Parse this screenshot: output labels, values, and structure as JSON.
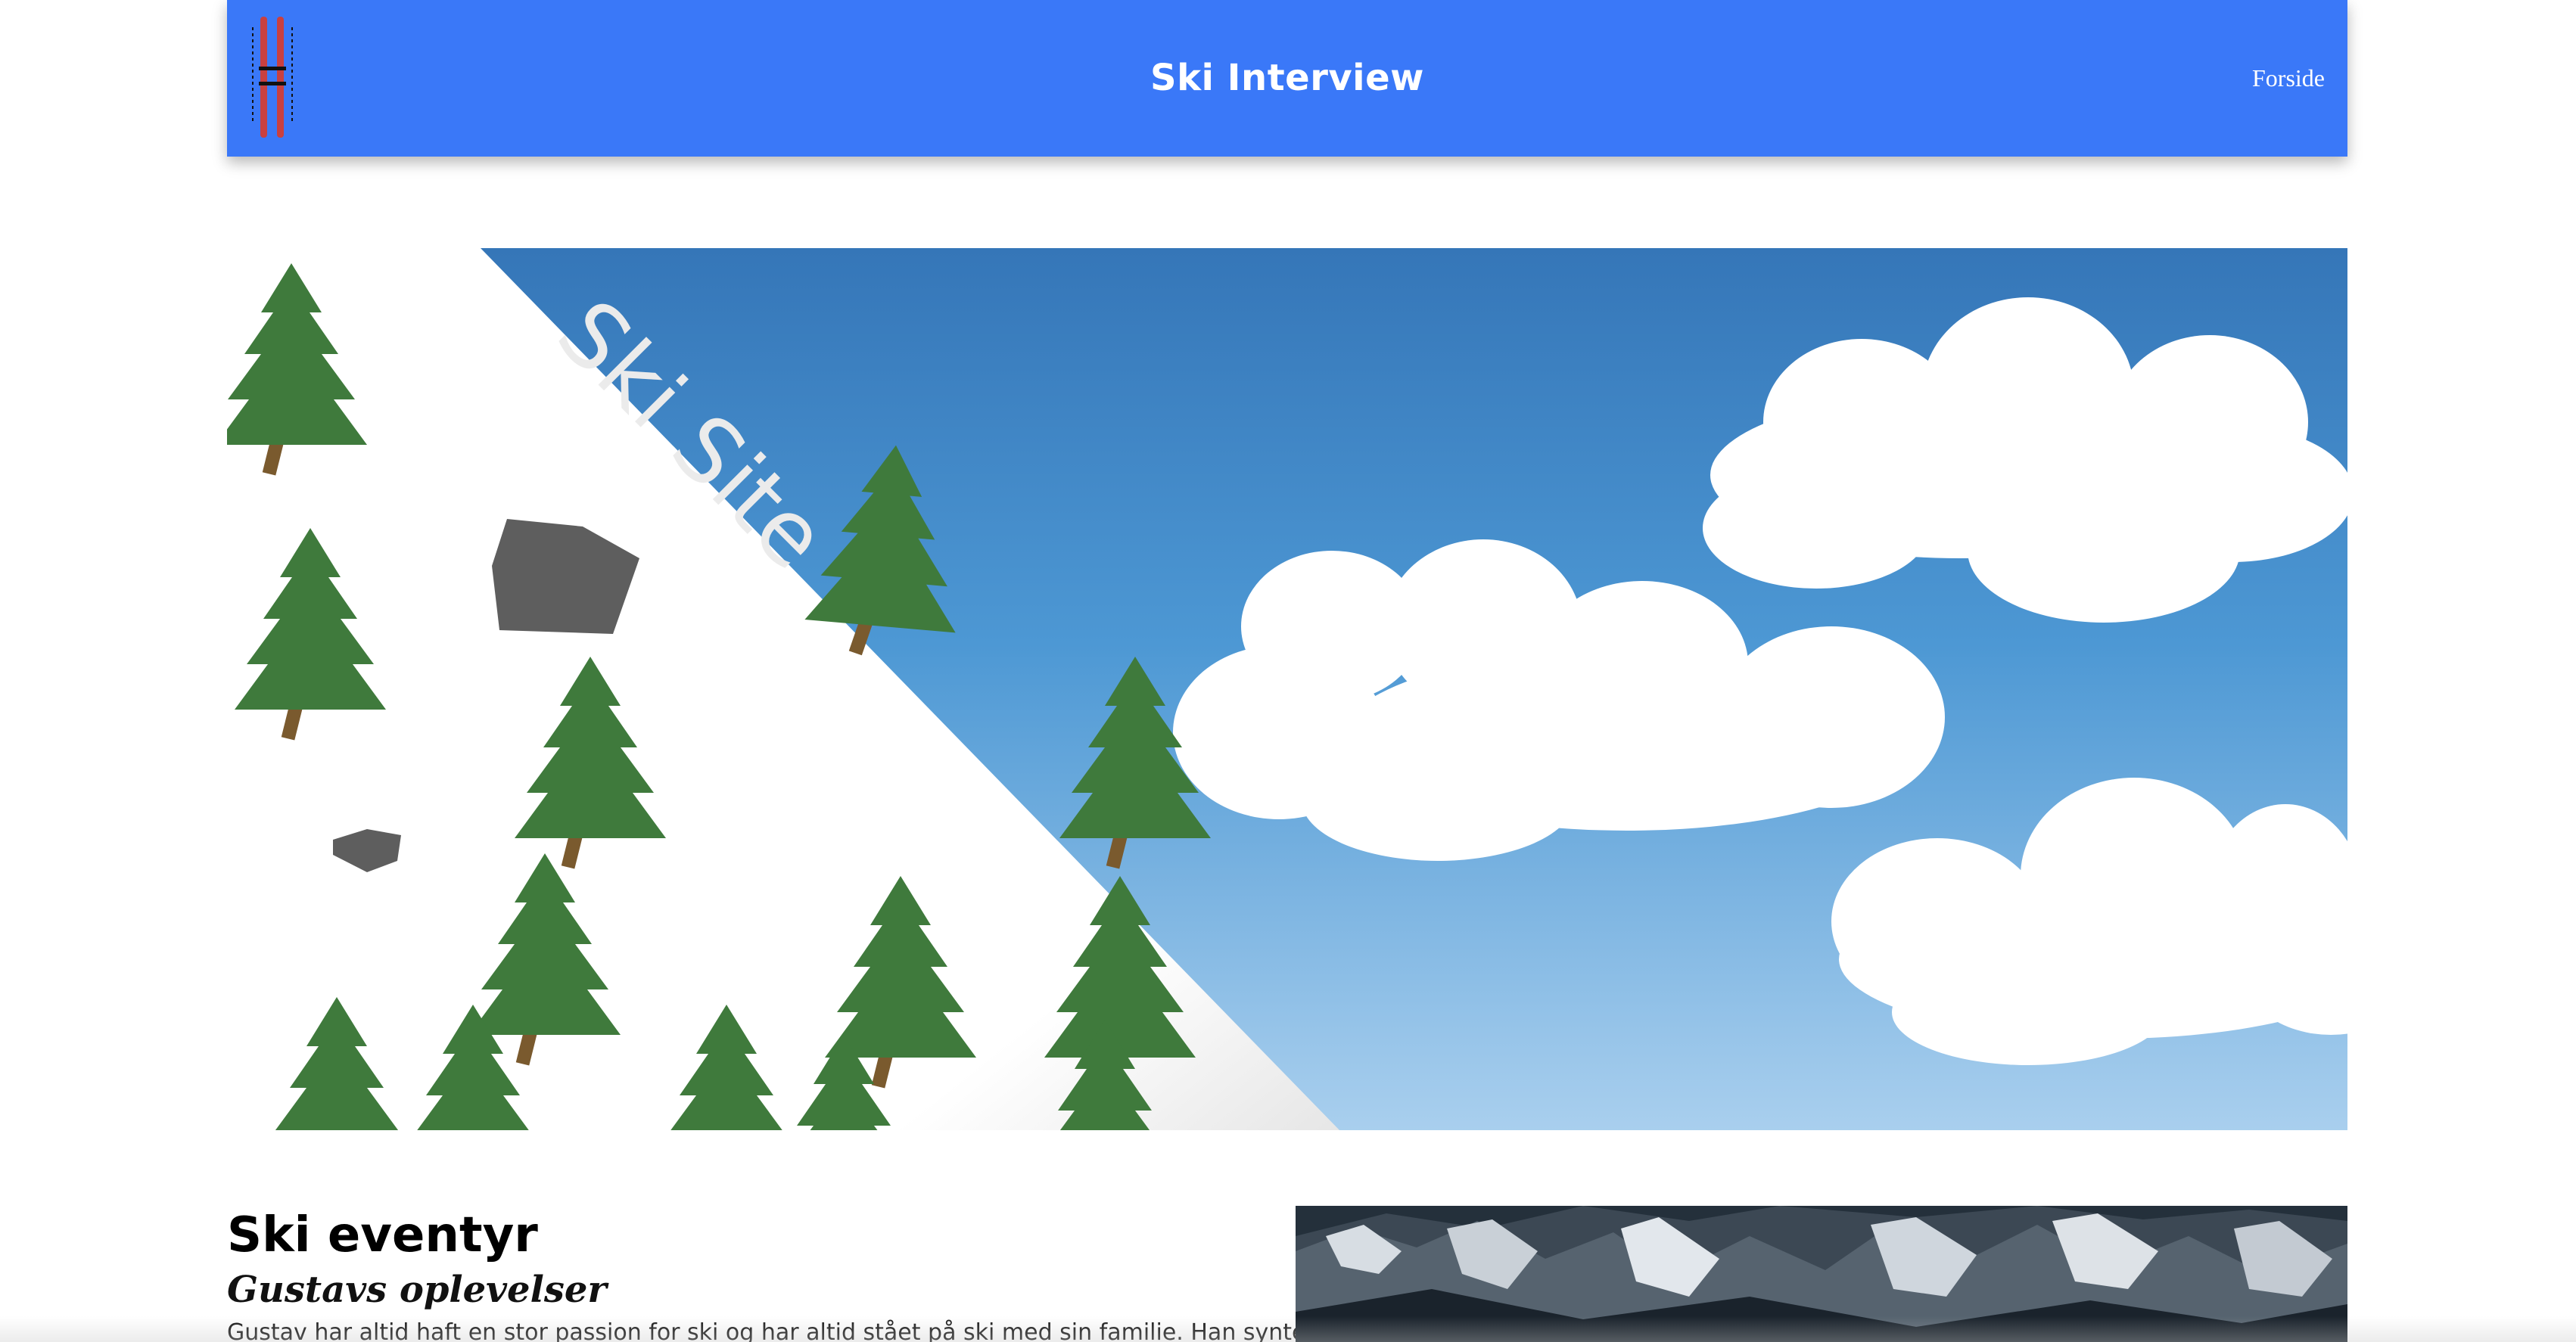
{
  "header": {
    "title": "Ski Interview",
    "nav_link": "Forside",
    "logo_icon": "skis-icon",
    "background_color": "#3a78f8"
  },
  "hero": {
    "banner_text": "Ski Site",
    "sky_color_top": "#3576b8",
    "sky_color_bottom": "#a7cdec",
    "tree_color": "#3f7a3c",
    "trunk_color": "#7a5a2e",
    "rock_color": "#5e5e5e"
  },
  "article": {
    "title": "Ski eventyr",
    "subtitle": "Gustavs oplevelser",
    "body_start": "Gustav har altid haft en stor passion for ski og har altid stået på ski med sin familie. Han syntes at",
    "photo_icon": "mountain-photo"
  }
}
